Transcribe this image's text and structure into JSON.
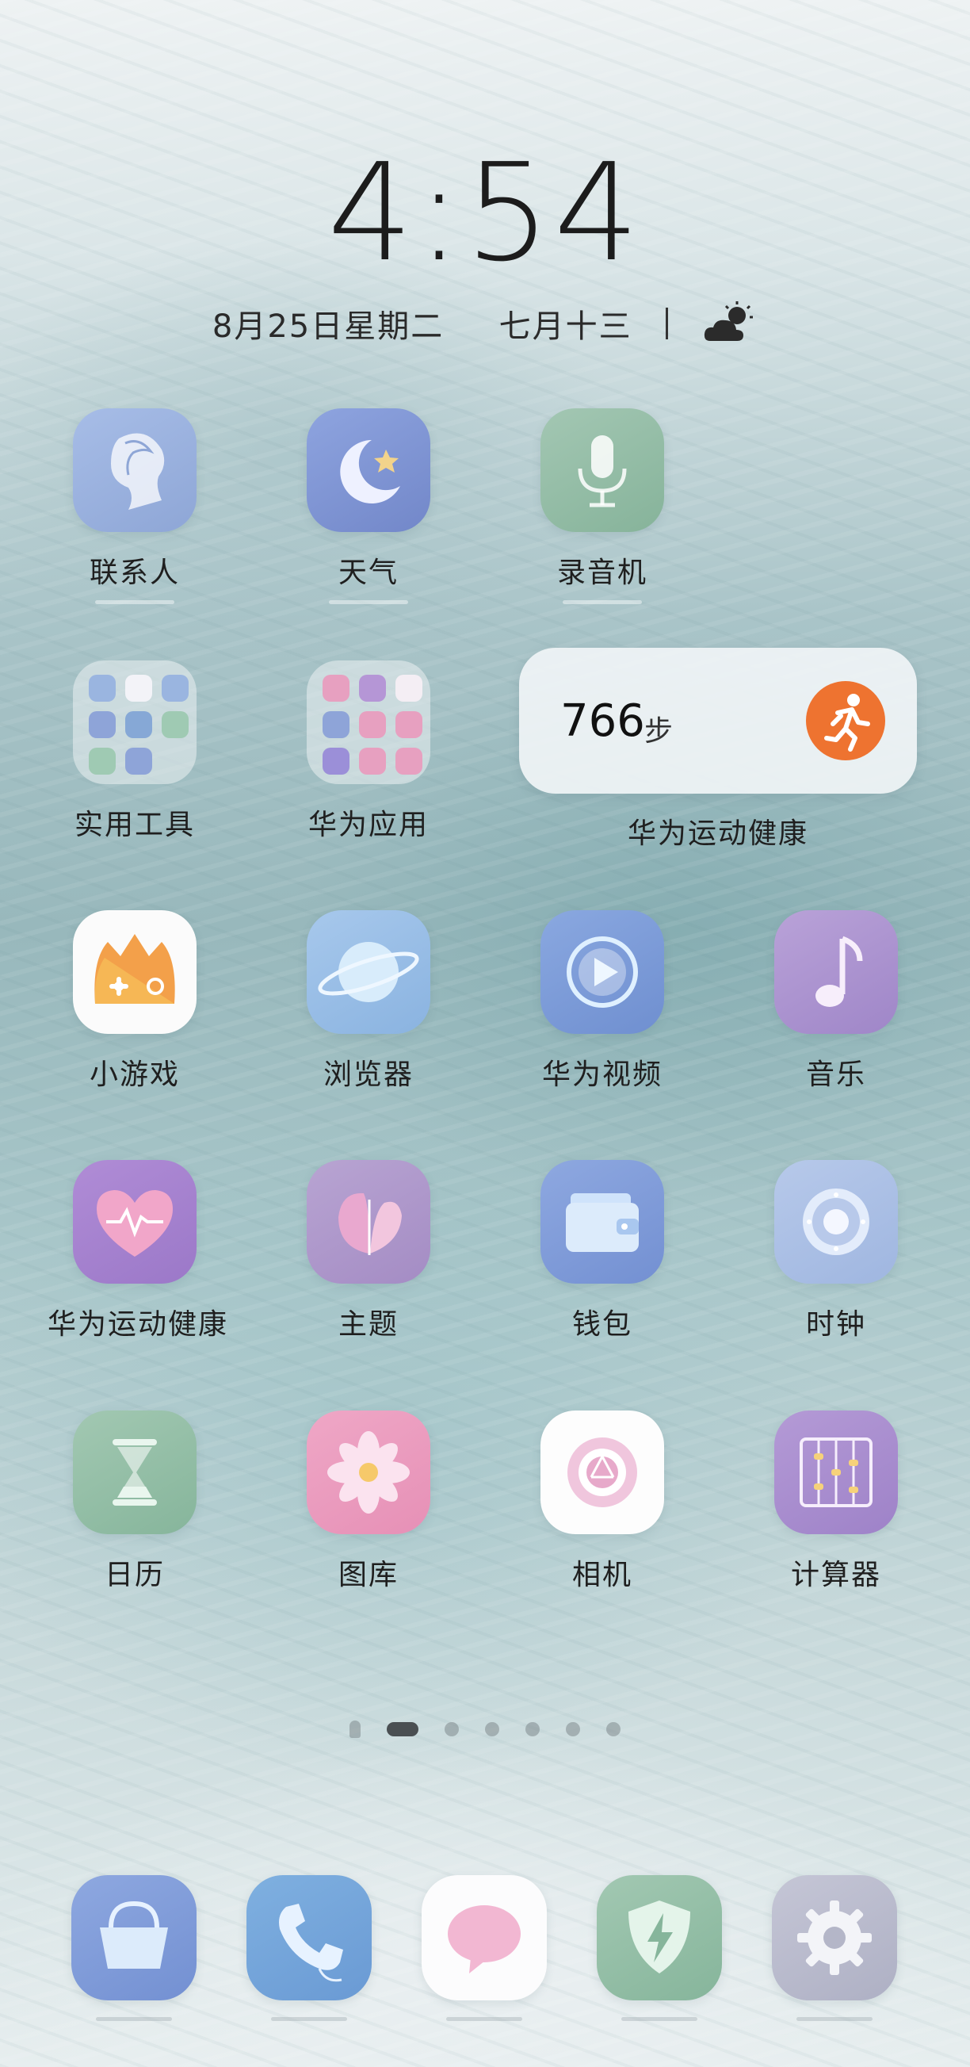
{
  "status": {
    "time": "4:54",
    "date": "8月25日星期二",
    "lunar_date": "七月十三",
    "weather_icon": "partly-cloudy-icon"
  },
  "apps": [
    {
      "label": "联系人",
      "icon": "contacts-icon"
    },
    {
      "label": "天气",
      "icon": "weather-moon-icon"
    },
    {
      "label": "录音机",
      "icon": "microphone-icon"
    },
    {
      "label": "实用工具",
      "icon": "folder-icon"
    },
    {
      "label": "华为应用",
      "icon": "folder-icon"
    },
    {
      "label": "小游戏",
      "icon": "game-controller-icon"
    },
    {
      "label": "浏览器",
      "icon": "planet-icon"
    },
    {
      "label": "华为视频",
      "icon": "play-icon"
    },
    {
      "label": "音乐",
      "icon": "music-note-icon"
    },
    {
      "label": "华为运动健康",
      "icon": "heart-icon"
    },
    {
      "label": "主题",
      "icon": "butterfly-icon"
    },
    {
      "label": "钱包",
      "icon": "wallet-icon"
    },
    {
      "label": "时钟",
      "icon": "clock-icon"
    },
    {
      "label": "日历",
      "icon": "hourglass-icon"
    },
    {
      "label": "图库",
      "icon": "flower-icon"
    },
    {
      "label": "相机",
      "icon": "camera-aperture-icon"
    },
    {
      "label": "计算器",
      "icon": "abacus-icon"
    }
  ],
  "health_widget": {
    "steps": "766",
    "unit": "步",
    "label": "华为运动健康",
    "icon": "runner-icon",
    "accent": "#ee7330"
  },
  "page_indicator": {
    "pages": 6,
    "current": 1
  },
  "dock": [
    {
      "icon": "shopping-basket-icon"
    },
    {
      "icon": "phone-icon"
    },
    {
      "icon": "message-bubble-icon"
    },
    {
      "icon": "shield-bolt-icon"
    },
    {
      "icon": "gear-icon"
    }
  ]
}
